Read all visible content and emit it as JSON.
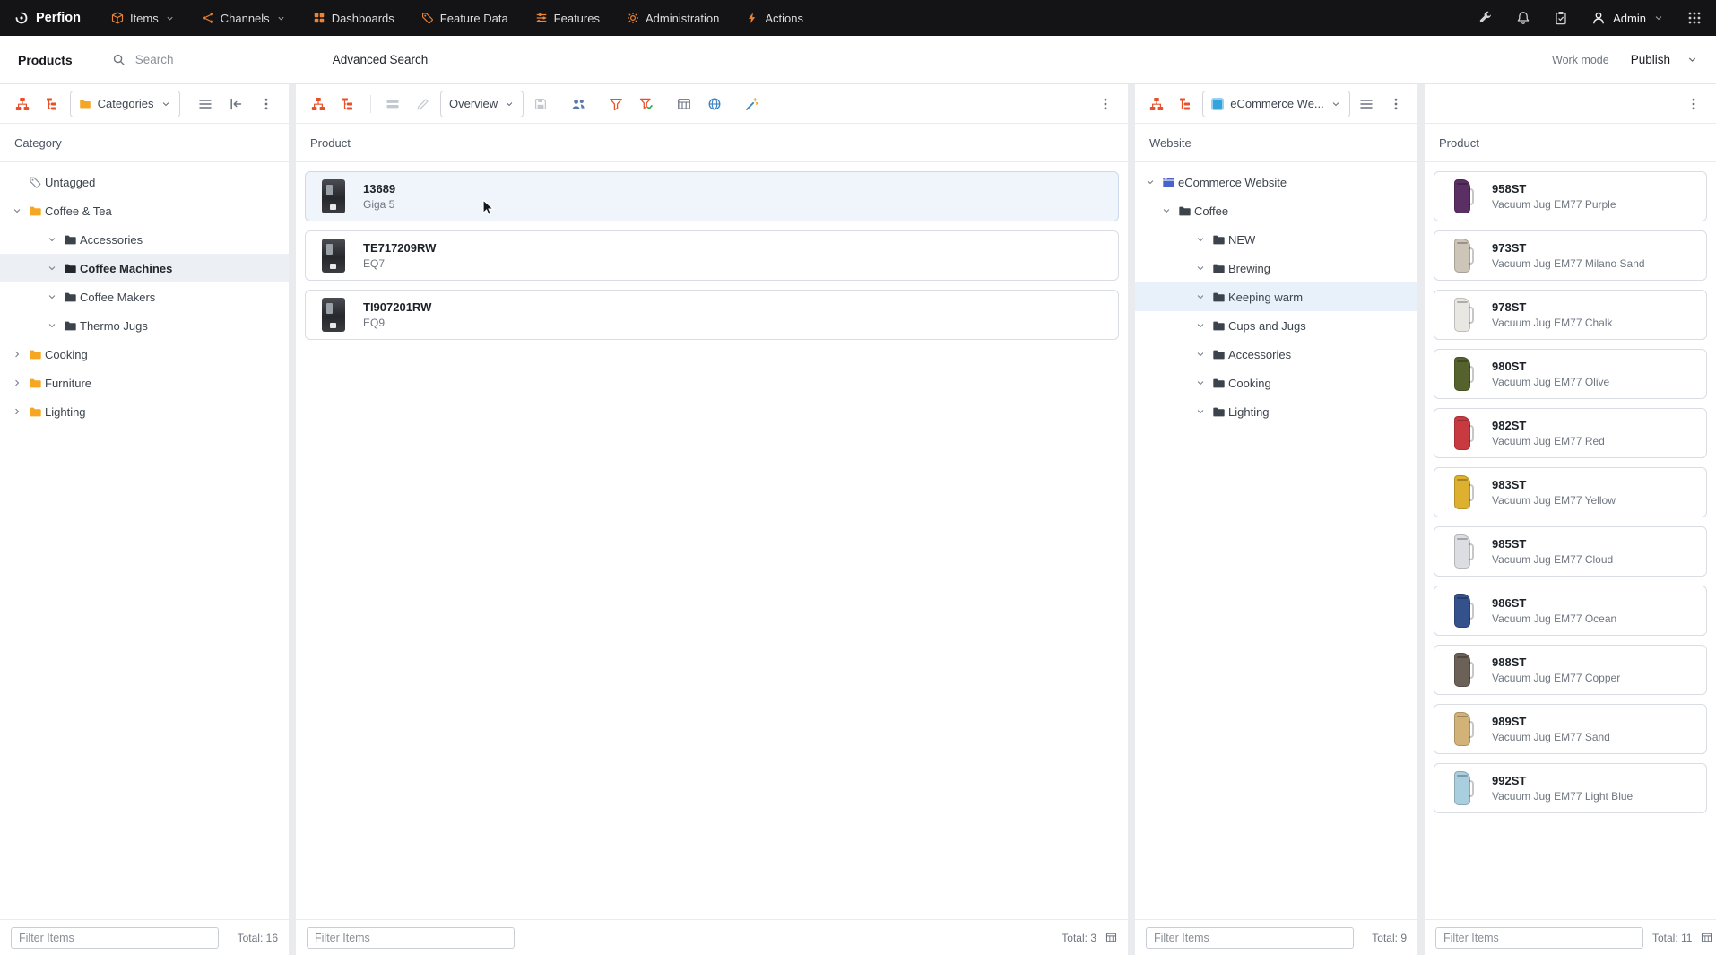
{
  "colors": {
    "accent_orange": "#e8502a",
    "folder_yellow": "#f5a623",
    "site_blue": "#4a63c8",
    "nav_icon_orange": "#ef8332",
    "selected_row_gray": "#eceff3",
    "selected_row_blue": "#e8f1fa",
    "selected_card_blue": "#f0f5fb"
  },
  "navbar": {
    "brand": "Perfion",
    "items": [
      {
        "label": "Items",
        "icon": "cube",
        "caret": true
      },
      {
        "label": "Channels",
        "icon": "channels",
        "caret": true
      },
      {
        "label": "Dashboards",
        "icon": "grid4",
        "caret": false
      },
      {
        "label": "Feature Data",
        "icon": "tags",
        "caret": false
      },
      {
        "label": "Features",
        "icon": "sliders",
        "caret": false
      },
      {
        "label": "Administration",
        "icon": "gear",
        "caret": false
      },
      {
        "label": "Actions",
        "icon": "bolt",
        "caret": false
      }
    ],
    "user_label": "Admin"
  },
  "subheader": {
    "section_label": "Products",
    "search_placeholder": "Search",
    "advanced_search_label": "Advanced Search",
    "work_mode_label": "Work mode",
    "publish_label": "Publish"
  },
  "category_panel": {
    "selector_label": "Categories",
    "header": "Category",
    "tree": [
      {
        "label": "Untagged",
        "level": 0,
        "chevron": "none",
        "icon": "tag",
        "selected": false
      },
      {
        "label": "Coffee & Tea",
        "level": 0,
        "chevron": "down",
        "icon": "folder",
        "selected": false
      },
      {
        "label": "Accessories",
        "level": 1,
        "chevron": "none",
        "icon": "none",
        "selected": false
      },
      {
        "label": "Coffee Machines",
        "level": 1,
        "chevron": "none",
        "icon": "none",
        "selected": true
      },
      {
        "label": "Coffee Makers",
        "level": 1,
        "chevron": "none",
        "icon": "none",
        "selected": false
      },
      {
        "label": "Thermo Jugs",
        "level": 1,
        "chevron": "none",
        "icon": "none",
        "selected": false
      },
      {
        "label": "Cooking",
        "level": 0,
        "chevron": "right",
        "icon": "folder",
        "selected": false
      },
      {
        "label": "Furniture",
        "level": 0,
        "chevron": "right",
        "icon": "folder",
        "selected": false
      },
      {
        "label": "Lighting",
        "level": 0,
        "chevron": "right",
        "icon": "folder",
        "selected": false
      }
    ],
    "filter_placeholder": "Filter Items",
    "total": "Total: 16"
  },
  "product_panel": {
    "view_selector_label": "Overview",
    "header": "Product",
    "items": [
      {
        "code": "13689",
        "name": "Giga 5",
        "selected": true
      },
      {
        "code": "TE717209RW",
        "name": "EQ7",
        "selected": false
      },
      {
        "code": "TI907201RW",
        "name": "EQ9",
        "selected": false
      }
    ],
    "filter_placeholder": "Filter Items",
    "total": "Total: 3"
  },
  "website_panel": {
    "selector_label": "eCommerce We...",
    "header": "Website",
    "tree": [
      {
        "label": "eCommerce Website",
        "level": 0,
        "chevron": "down",
        "icon": "site",
        "selected": false
      },
      {
        "label": "Coffee",
        "level": 1,
        "chevron": "down",
        "icon": "none",
        "selected": false
      },
      {
        "label": "NEW",
        "level": 2,
        "chevron": "none",
        "icon": "none",
        "selected": false
      },
      {
        "label": "Brewing",
        "level": 2,
        "chevron": "none",
        "icon": "none",
        "selected": false
      },
      {
        "label": "Keeping warm",
        "level": 2,
        "chevron": "none",
        "icon": "none",
        "selected": true
      },
      {
        "label": "Cups and Jugs",
        "level": 2,
        "chevron": "none",
        "icon": "none",
        "selected": false
      },
      {
        "label": "Accessories",
        "level": 2,
        "chevron": "none",
        "icon": "none",
        "selected": false
      },
      {
        "label": "Cooking",
        "level": 2,
        "chevron": "none",
        "icon": "none",
        "selected": false
      },
      {
        "label": "Lighting",
        "level": 2,
        "chevron": "none",
        "icon": "none",
        "selected": false
      }
    ],
    "filter_placeholder": "Filter Items",
    "total": "Total: 9"
  },
  "right_product_panel": {
    "header": "Product",
    "items": [
      {
        "code": "958ST",
        "name": "Vacuum Jug EM77 Purple",
        "color": "#5b2f63"
      },
      {
        "code": "973ST",
        "name": "Vacuum Jug EM77 Milano Sand",
        "color": "#cdc5b8"
      },
      {
        "code": "978ST",
        "name": "Vacuum Jug EM77 Chalk",
        "color": "#e9e7e2"
      },
      {
        "code": "980ST",
        "name": "Vacuum Jug EM77 Olive",
        "color": "#55622e"
      },
      {
        "code": "982ST",
        "name": "Vacuum Jug EM77 Red",
        "color": "#c93a40"
      },
      {
        "code": "983ST",
        "name": "Vacuum Jug EM77 Yellow",
        "color": "#ddb12f"
      },
      {
        "code": "985ST",
        "name": "Vacuum Jug EM77 Cloud",
        "color": "#dcdde2"
      },
      {
        "code": "986ST",
        "name": "Vacuum Jug EM77 Ocean",
        "color": "#34518c"
      },
      {
        "code": "988ST",
        "name": "Vacuum Jug EM77 Copper",
        "color": "#6b6157"
      },
      {
        "code": "989ST",
        "name": "Vacuum Jug EM77 Sand",
        "color": "#d3b277"
      },
      {
        "code": "992ST",
        "name": "Vacuum Jug EM77 Light Blue",
        "color": "#a9cede"
      }
    ],
    "filter_placeholder": "Filter Items",
    "total": "Total: 11"
  }
}
